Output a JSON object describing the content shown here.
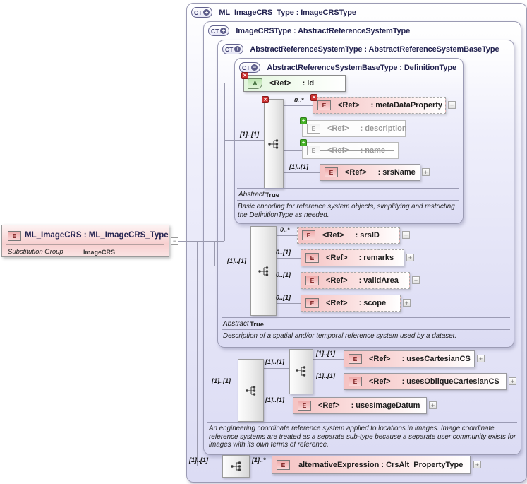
{
  "icons": {
    "complex_type": "CT",
    "plus": "+",
    "minus": "−",
    "element_letter": "E",
    "attribute_letter": "A",
    "prohibited_x": "✕",
    "extend_plus": "+",
    "expand_plus": "+",
    "collapse_minus": "−"
  },
  "colors": {
    "frame_border": "#9b9bb4",
    "element_pink": "#f5c3c3",
    "attribute_green": "#e2f5dd",
    "prohibited_red": "#cb3030",
    "extension_green": "#45b227",
    "title_navy": "#232350"
  },
  "left_element": {
    "title": "ML_ImageCRS : ML_ImageCRS_Type",
    "substitution_group_label": "Substitution Group",
    "substitution_group_value": "ImageCRS"
  },
  "frame1": {
    "title": "ML_ImageCRS_Type : ImageCRSType",
    "seq_card": "[1]..[1]",
    "alternative": {
      "card": "[1]..*",
      "label": "alternativeExpression : CrsAlt_PropertyType"
    }
  },
  "frame2": {
    "title": "ImageCRSType : AbstractReferenceSystemType",
    "seq_card": "[1]..[1]",
    "choice_card": "[1]..[1]",
    "uses_cartesian": {
      "card": "[1]..[1]",
      "ref": "<Ref>",
      "name": ": usesCartesianCS"
    },
    "uses_oblique": {
      "card": "[1]..[1]",
      "ref": "<Ref>",
      "name": ": usesObliqueCartesianCS"
    },
    "uses_image_datum": {
      "card": "[1]..[1]",
      "ref": "<Ref>",
      "name": ": usesImageDatum"
    },
    "annotation": "An engineering coordinate reference system applied to locations in images. Image coordinate reference systems are treated as a separate sub-type because a separate user community exists for images with its own terms of reference."
  },
  "frame3": {
    "title": "AbstractReferenceSystemType : AbstractReferenceSystemBaseType",
    "seq_card": "[1]..[1]",
    "srs_id": {
      "card": "0..*",
      "ref": "<Ref>",
      "name": ": srsID"
    },
    "remarks": {
      "card": "0..[1]",
      "ref": "<Ref>",
      "name": ": remarks"
    },
    "valid_area": {
      "card": "0..[1]",
      "ref": "<Ref>",
      "name": ": validArea"
    },
    "scope": {
      "card": "0..[1]",
      "ref": "<Ref>",
      "name": ": scope"
    },
    "abstract_label": "Abstract",
    "abstract_value": "True",
    "annotation": "Description of a spatial and/or temporal reference system used by a dataset."
  },
  "frame4": {
    "title": "AbstractReferenceSystemBaseType : DefinitionType",
    "seq_card": "[1]..[1]",
    "attr_id": {
      "ref": "<Ref>",
      "name": ": id"
    },
    "meta_data_property": {
      "card": "0..*",
      "ref": "<Ref>",
      "name": ": metaDataProperty"
    },
    "description_row": {
      "ref": "<Ref>",
      "name": ": description"
    },
    "name_row": {
      "ref": "<Ref>",
      "name": ": name"
    },
    "srs_name": {
      "card": "[1]..[1]",
      "ref": "<Ref>",
      "name": ": srsName"
    },
    "abstract_label": "Abstract",
    "abstract_value": "True",
    "annotation": "Basic encoding for reference system objects, simplifying and restricting the DefinitionType as needed."
  }
}
